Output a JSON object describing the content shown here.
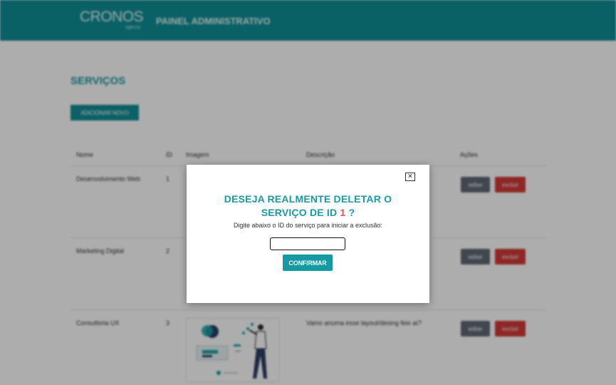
{
  "header": {
    "logo": "CRONOS",
    "logo_sub": "agência",
    "title": "PAINEL ADMINISTRATIVO"
  },
  "page": {
    "section_title": "SERVIÇOS",
    "add_button": "ADICIONAR NOVO"
  },
  "table": {
    "columns": [
      "Nome",
      "ID",
      "Imagem",
      "Descrição",
      "Ações"
    ],
    "rows": [
      {
        "name": "Desenvolvimento Web",
        "id": "1",
        "description": "",
        "edit": "editar",
        "delete": "excluir"
      },
      {
        "name": "Marketing Digital",
        "id": "2",
        "description": "",
        "edit": "editar",
        "delete": "excluir"
      },
      {
        "name": "Consultoria UX",
        "id": "3",
        "description": "Vamo anuma esse layout/desing feio aí?",
        "edit": "editar",
        "delete": "excluir"
      }
    ]
  },
  "modal": {
    "title_line1": "DESEJA REALMENTE DELETAR O",
    "title_line2_prefix": "SERVIÇO DE ID ",
    "title_id": "1",
    "title_line2_suffix": " ?",
    "instruction": "Digite abaixo o ID do serviço para iniciar a exclusão:",
    "input_value": "",
    "confirm_label": "CONFIRMAR",
    "close_symbol": "✕"
  },
  "colors": {
    "accent": "#0e8f97",
    "danger": "#d33a3a",
    "id_highlight": "#e0524d"
  }
}
